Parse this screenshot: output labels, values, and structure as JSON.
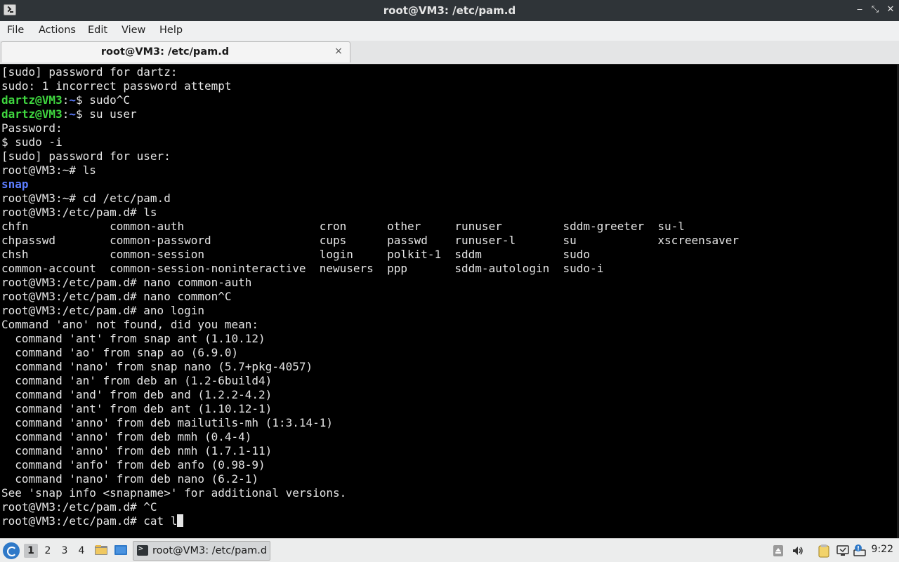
{
  "window": {
    "title": "root@VM3: /etc/pam.d",
    "controls": {
      "minimize": "‒",
      "maximize": "⤡",
      "close": "✕"
    }
  },
  "menu": [
    "File",
    "Actions",
    "Edit",
    "View",
    "Help"
  ],
  "tab": {
    "label": "root@VM3: /etc/pam.d",
    "close": "×"
  },
  "terminal": {
    "lines": [
      {
        "t": "[sudo] password for dartz:"
      },
      {
        "t": "sudo: 1 incorrect password attempt"
      },
      {
        "u": "dartz@VM3",
        "h": "~",
        "t": "$ sudo^C"
      },
      {
        "u": "dartz@VM3",
        "h": "~",
        "t": "$ su user"
      },
      {
        "t": "Password:"
      },
      {
        "t": "$ sudo -i"
      },
      {
        "t": "[sudo] password for user:"
      },
      {
        "t": "root@VM3:~# ls"
      },
      {
        "d": "snap"
      },
      {
        "t": "root@VM3:~# cd /etc/pam.d"
      },
      {
        "t": "root@VM3:/etc/pam.d# ls"
      },
      {
        "t": "chfn            common-auth                    cron      other     runuser         sddm-greeter  su-l"
      },
      {
        "t": "chpasswd        common-password                cups      passwd    runuser-l       su            xscreensaver"
      },
      {
        "t": "chsh            common-session                 login     polkit-1  sddm            sudo"
      },
      {
        "t": "common-account  common-session-noninteractive  newusers  ppp       sddm-autologin  sudo-i"
      },
      {
        "t": "root@VM3:/etc/pam.d# nano common-auth"
      },
      {
        "t": "root@VM3:/etc/pam.d# nano common^C"
      },
      {
        "t": "root@VM3:/etc/pam.d# ano login"
      },
      {
        "t": "Command 'ano' not found, did you mean:"
      },
      {
        "t": "  command 'ant' from snap ant (1.10.12)"
      },
      {
        "t": "  command 'ao' from snap ao (6.9.0)"
      },
      {
        "t": "  command 'nano' from snap nano (5.7+pkg-4057)"
      },
      {
        "t": "  command 'an' from deb an (1.2-6build4)"
      },
      {
        "t": "  command 'and' from deb and (1.2.2-4.2)"
      },
      {
        "t": "  command 'ant' from deb ant (1.10.12-1)"
      },
      {
        "t": "  command 'anno' from deb mailutils-mh (1:3.14-1)"
      },
      {
        "t": "  command 'anno' from deb mmh (0.4-4)"
      },
      {
        "t": "  command 'anno' from deb nmh (1.7.1-11)"
      },
      {
        "t": "  command 'anfo' from deb anfo (0.98-9)"
      },
      {
        "t": "  command 'nano' from deb nano (6.2-1)"
      },
      {
        "t": "See 'snap info <snapname>' for additional versions."
      },
      {
        "t": "root@VM3:/etc/pam.d# ^C"
      },
      {
        "t": "root@VM3:/etc/pam.d# cat l",
        "cursor": true
      }
    ]
  },
  "taskbar": {
    "workspaces": [
      "1",
      "2",
      "3",
      "4"
    ],
    "active_workspace": "1",
    "task_label": "root@VM3: /etc/pam.d",
    "clock": "9:22"
  },
  "colors": {
    "user_prompt": "#3fd63f",
    "path": "#5c7dff",
    "terminal_bg": "#000000",
    "terminal_fg": "#e5e5e5"
  }
}
